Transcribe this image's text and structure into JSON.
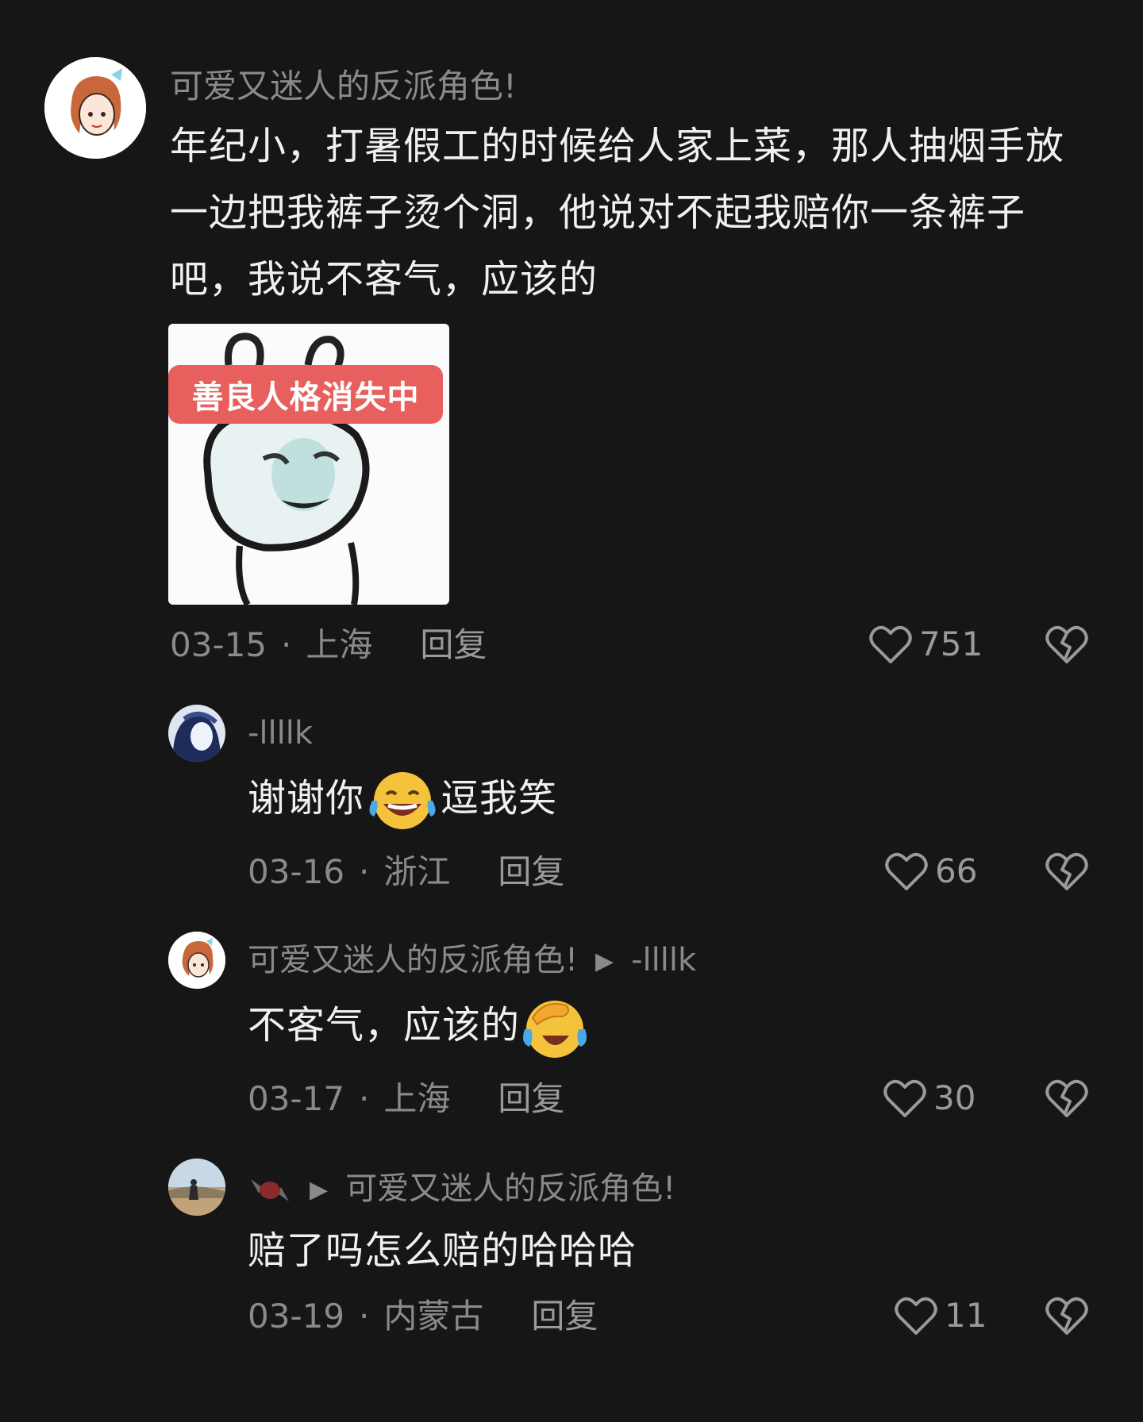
{
  "main_comment": {
    "username": "可爱又迷人的反派角色!",
    "text": "年纪小，打暑假工的时候给人家上菜，那人抽烟手放一边把我裤子烫个洞，他说对不起我赔你一条裤子吧，我说不客气，应该的",
    "sticker_label": "善良人格消失中",
    "date": "03-15",
    "location": "上海",
    "reply_label": "回复",
    "likes": "751"
  },
  "replies": [
    {
      "username": "-llllk",
      "reply_to": "",
      "text_before": "谢谢你",
      "emoji": "laughing-face",
      "text_after": "逗我笑",
      "date": "03-16",
      "location": "浙江",
      "reply_label": "回复",
      "likes": "66"
    },
    {
      "username": "可爱又迷人的反派角色!",
      "reply_to": "-llllk",
      "text_before": "不客气，应该的",
      "emoji": "facepalm-crying-face",
      "text_after": "",
      "date": "03-17",
      "location": "上海",
      "reply_label": "回复",
      "likes": "30"
    },
    {
      "username": "",
      "reply_to": "可爱又迷人的反派角色!",
      "text_before": "赔了吗怎么赔的哈哈哈",
      "emoji": "",
      "text_after": "",
      "date": "03-19",
      "location": "内蒙古",
      "reply_label": "回复",
      "likes": "11"
    }
  ],
  "colors": {
    "background": "#161616",
    "text_primary": "#f0f0f0",
    "text_secondary": "#8a8a8a",
    "sticker_label_bg": "#e8605d"
  },
  "icons": [
    "heart-outline-icon",
    "broken-heart-icon",
    "play-arrow-icon",
    "candy-icon"
  ]
}
